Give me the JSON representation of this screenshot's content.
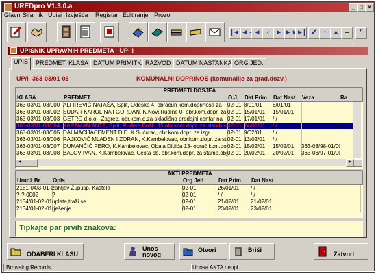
{
  "app": {
    "title": "UREDpro V1.3.0.a"
  },
  "menu": [
    "Glavni",
    "Šifarnik",
    "Upisi",
    "Izvješća",
    "Registar",
    "Editiranje",
    "Prozori"
  ],
  "toolbar": {
    "icons": [
      "edit-doc-icon",
      "handshake-icon",
      "cabinet-icon",
      "form-icon",
      "printer-doc-icon",
      "folders-icon",
      "book-icon",
      "stack-icon",
      "scanner-icon",
      "envelope-icon"
    ],
    "nav": [
      {
        "name": "first-record-button",
        "glyph": "|◄"
      },
      {
        "name": "prev-page-button",
        "glyph": "◄◄"
      },
      {
        "name": "prev-record-button",
        "glyph": "◄"
      },
      {
        "name": "next-record-button",
        "glyph": "►"
      },
      {
        "name": "next-page-button",
        "glyph": "►►"
      },
      {
        "name": "last-record-button",
        "glyph": "►|"
      },
      {
        "name": "confirm-button",
        "glyph": "✔"
      },
      {
        "name": "add-record-button",
        "glyph": "+"
      },
      {
        "name": "delete-record-button",
        "glyph": "▲"
      },
      {
        "name": "remove-record-button",
        "glyph": "–"
      },
      {
        "name": "help-button",
        "glyph": "\""
      }
    ]
  },
  "window": {
    "title": "UPISNIK UPRAVNIH PREDMETA - UP- I"
  },
  "tabs": [
    "UPIS",
    "PREDMET",
    "KLASA",
    "DATUM PRIMITKA",
    "RAZVOD",
    "DATUM NASTANKA",
    "ORG.JED."
  ],
  "record": {
    "klasa": "UP/I- 363-03/01-03",
    "description": "KOMUNALNI DOPRINOS (komunalije za grad.dozv.)"
  },
  "predmeti": {
    "title": "PREDMETI DOSJEA",
    "columns": [
      "KLASA",
      "PREDMET",
      "O.J.",
      "Dat Prim",
      "Dat Nast",
      "Veza",
      "Ra"
    ],
    "rows": [
      [
        "363-03/01-03/000",
        "ALFIREVIĆ NATAŠA, Split, Odeska 4, obračun kom.doprinosa za",
        "02-01",
        "8/01/01",
        "8/01/01",
        "",
        ""
      ],
      [
        "363-03/01-03/002",
        "SUDAR KAROLINA I GORDAN, K.Novi,Rudine 0- obr.kom.dopr. za s",
        "02-01",
        "15/01/01",
        "15/01/01",
        "",
        ""
      ],
      [
        "363-03/01-03/003",
        "GETRO d.o.o. -Zagreb, obr.kom.d.za skladišno prodajni centar na",
        "02-01",
        "17/01/01",
        "/ /",
        "",
        ""
      ],
      [
        "363-03/01-03/004",
        "KARAMAN ANTE, Split, Ruđera Bošk. 15 obr.kom.dopr. za stamb.objekt",
        "02-01",
        "24/01/01",
        "/ /",
        "",
        ""
      ],
      [
        "363-03/01-03/005",
        "DALMACIJACEMENT D.D. K.Sućurac, obr.kom.dopr. za izgr",
        "02-01",
        "9/02/01",
        "/ /",
        "",
        ""
      ],
      [
        "363-03/01-03/006",
        "RAJKOVIĆ MLADEN I ZORAN, K.Kambelovac, obr.kom.dopr. za sta",
        "02-01",
        "13/02/01",
        "/ /",
        "",
        ""
      ],
      [
        "363-03/01-03/007",
        "DUMANČIĆ PERO, K.Kambelovac, Obala Didića 13- obrač.kom.dop",
        "02-01",
        "15/02/01",
        "15/02/01",
        "363-03/98-01/00",
        ""
      ],
      [
        "363-03/01-03/008",
        "BALOV IVAN, K.Kambelovac, Cesta bb, obr.kom.dopr. za stamb.obj",
        "02-01",
        "20/02/01",
        "20/02/01",
        "363-03/97-01/00",
        ""
      ]
    ]
  },
  "akti": {
    "title": "AKTI PREDMETA",
    "columns": [
      "Urudž Br",
      "Opis",
      "Org Jed",
      "Dat Prim",
      "Dat Nast"
    ],
    "rows": [
      [
        "2181-04/3-01-0001",
        "zahtjev Žup.isp. Kaštela",
        "02-01",
        "26/01/01",
        "/ /"
      ],
      [
        "?-?-0002",
        "?",
        "02-01",
        "/ /",
        "/ /"
      ],
      [
        "2134/01-02-01-01-0",
        "uplata,traži se",
        "02-01",
        "21/02/01",
        "21/02/01"
      ],
      [
        "2134/01-02-01-01-0",
        "rješenje",
        "02-01",
        "23/02/01",
        "23/02/01"
      ]
    ]
  },
  "search_hint": "Tipkajte par prvih znakova:",
  "buttons": {
    "odaberi": "ODABERI KLASU",
    "unos": "Unos",
    "unos2": "novog",
    "otvori": "Otvori",
    "brisi": "Briši",
    "zatvori": "Zatvori"
  },
  "status": {
    "left": "Browsing Records",
    "right": "Unosa AKTA neupi."
  },
  "colors": {
    "title_red": "#8b0000",
    "selected_row": "#00007f",
    "selected_text_red": "#ff2020",
    "grid_yellow": "#fffacd",
    "hint_green": "#1f6f3f"
  }
}
